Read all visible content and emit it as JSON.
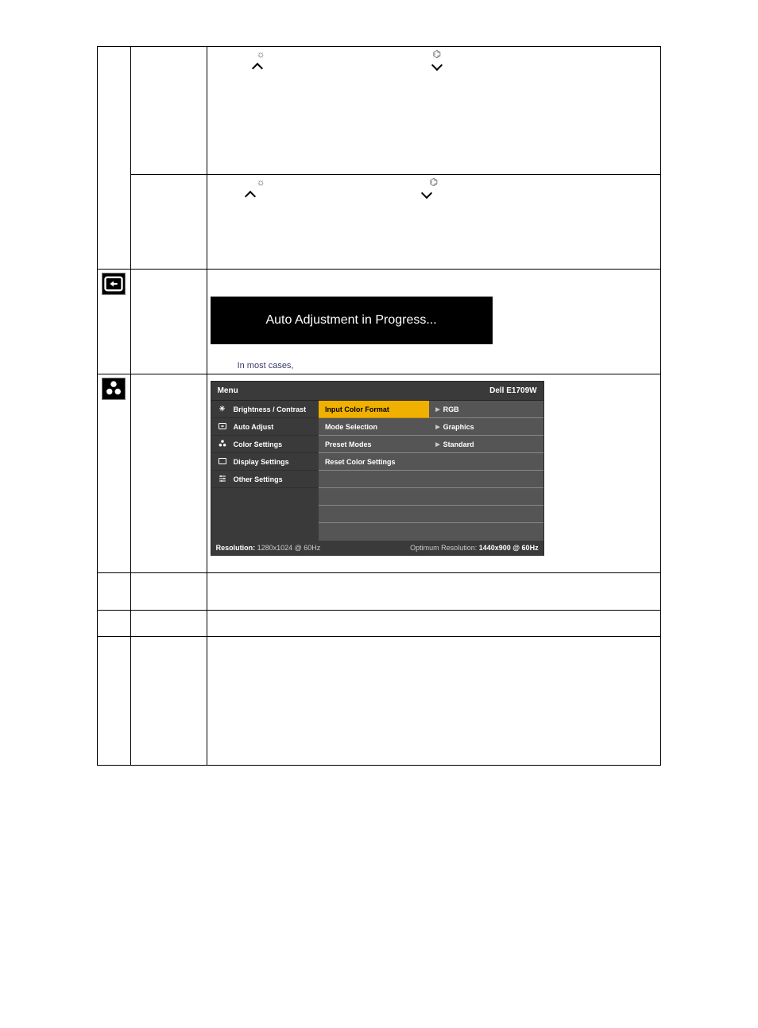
{
  "row1": {
    "sun_glyph": "☼",
    "camera_glyph": "⌬"
  },
  "row2": {
    "sun_glyph": "☼",
    "camera_glyph": "⌬"
  },
  "auto": {
    "banner": "Auto Adjustment in Progress...",
    "note": "In most cases,"
  },
  "osd": {
    "menu_label": "Menu",
    "model": "Dell E1709W",
    "left": [
      "Brightness /  Contrast",
      "Auto Adjust",
      "Color Settings",
      "Display Settings",
      "Other Settings"
    ],
    "mid": [
      "Input Color Format",
      "Mode Selection",
      "Preset Modes",
      "Reset Color Settings"
    ],
    "right": [
      "RGB",
      "Graphics",
      "Standard"
    ],
    "footer_left_label": "Resolution:",
    "footer_left_value": "1280x1024 @ 60Hz",
    "footer_right_label": "Optimum Resolution:",
    "footer_right_value": "1440x900 @ 60Hz"
  }
}
